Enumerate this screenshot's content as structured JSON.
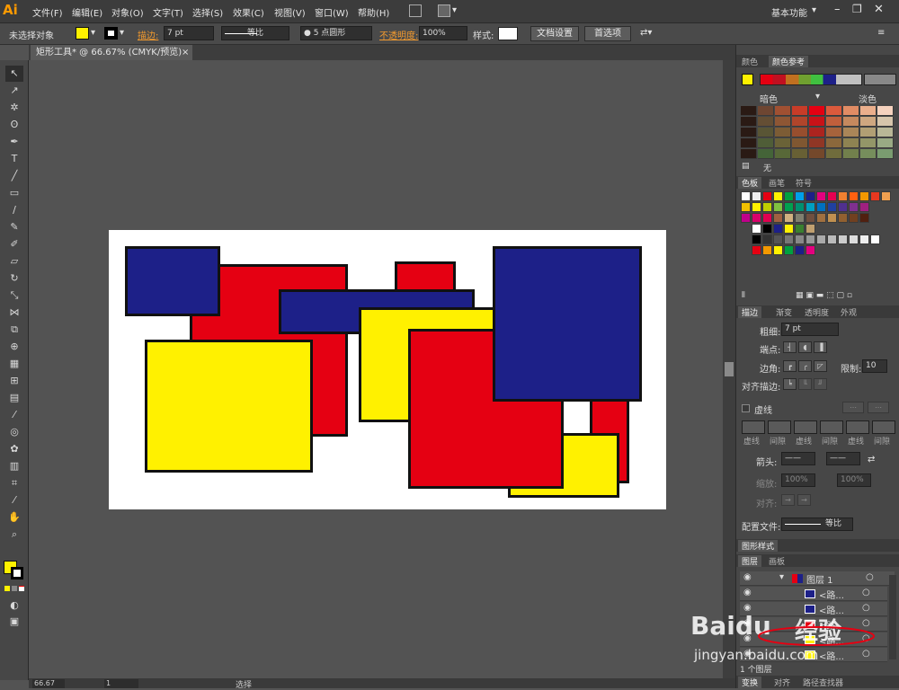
{
  "app": {
    "logo": "Ai"
  },
  "menu": [
    "文件(F)",
    "编辑(E)",
    "对象(O)",
    "文字(T)",
    "选择(S)",
    "效果(C)",
    "视图(V)",
    "窗口(W)",
    "帮助(H)"
  ],
  "workspace": "基本功能",
  "control": {
    "selection": "未选择对象",
    "stroke_label": "描边:",
    "stroke_value": "7 pt",
    "profile": "等比",
    "brush": "● 5 点圆形",
    "opacity_label": "不透明度:",
    "opacity_value": "100%",
    "style_label": "样式:",
    "doc_setup": "文档设置",
    "preferences": "首选项"
  },
  "document": {
    "tab": "矩形工具* @ 66.67% (CMYK/预览)",
    "close": "×"
  },
  "colors": {
    "red": "#e50012",
    "blue": "#1d2088",
    "yellow": "#fff100",
    "stroke": "#111111"
  },
  "status": {
    "zoom": "66.67",
    "page": "1",
    "tool": "选择"
  },
  "panels": {
    "color_tabs": [
      "颜色",
      "颜色参考"
    ],
    "guide_left": "暗色",
    "guide_right": "淡色",
    "none_label": "无",
    "swatch_tabs": [
      "色板",
      "画笔",
      "符号"
    ],
    "stroke_tabs": [
      "描边",
      "渐变",
      "透明度",
      "外观"
    ],
    "weight_label": "粗细:",
    "weight_value": "7 pt",
    "cap_label": "端点:",
    "corner_label": "边角:",
    "limit_label": "限制:",
    "limit_value": "10",
    "align_label": "对齐描边:",
    "dashed_label": "虚线",
    "dash_labels": [
      "虚线",
      "间隙",
      "虚线",
      "间隙",
      "虚线",
      "间隙"
    ],
    "arrow_label": "箭头:",
    "scale_label": "缩放:",
    "scale_a": "100%",
    "scale_b": "100%",
    "align2_label": "对齐:",
    "profile_label": "配置文件:",
    "profile_value": "等比",
    "graphic_style_tab": "图形样式",
    "layer_tabs": [
      "图层",
      "画板"
    ],
    "layer_name": "图层 1",
    "layer_items": [
      "<路...",
      "<路...",
      "<路...",
      "<路...",
      "<路..."
    ],
    "layer_count": "1 个图层",
    "bottom_tabs": [
      "变换",
      "对齐",
      "路径查找器"
    ]
  },
  "watermark": {
    "brand": "Baidu",
    "cn": "经验",
    "url": "jingyan.baidu.com"
  }
}
